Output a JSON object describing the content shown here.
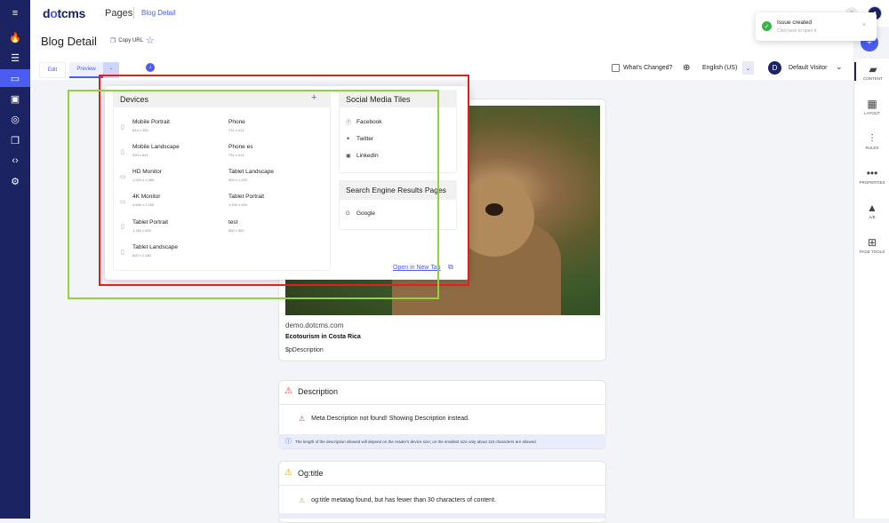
{
  "sidebar": {
    "menu_icon": "menu-icon",
    "items": [
      {
        "icon": "fire-icon",
        "glyph": "🔥"
      },
      {
        "icon": "list-icon",
        "glyph": "☰"
      },
      {
        "icon": "folder-icon",
        "glyph": "▭"
      },
      {
        "icon": "image-icon",
        "glyph": "▣"
      },
      {
        "icon": "target-icon",
        "glyph": "◎"
      },
      {
        "icon": "copy-icon",
        "glyph": "❐"
      },
      {
        "icon": "code-icon",
        "glyph": "‹›"
      },
      {
        "icon": "gear-icon",
        "glyph": "⚙"
      }
    ]
  },
  "header": {
    "logo_prefix": "d",
    "logo_dot": "o",
    "logo_suffix": "tcms",
    "breadcrumb_root": "Pages",
    "breadcrumb_current": "Blog Detail"
  },
  "titlebar": {
    "page_title": "Blog Detail",
    "copy_url": "Copy URL"
  },
  "toolbar": {
    "tab_edit": "Edit",
    "tab_preview": "Preview",
    "whats_changed": "What's Changed?",
    "language": "English (US)",
    "visitor_initial": "D",
    "visitor": "Default Visitor"
  },
  "right_panel": [
    {
      "label": "CONTENT",
      "icon": "content-icon",
      "glyph": "▰"
    },
    {
      "label": "LAYOUT",
      "icon": "layout-icon",
      "glyph": "▦"
    },
    {
      "label": "RULES",
      "icon": "rules-icon",
      "glyph": "⫶"
    },
    {
      "label": "PROPERTIES",
      "icon": "properties-icon",
      "glyph": "•••"
    },
    {
      "label": "A/B",
      "icon": "ab-flask-icon",
      "glyph": "▲"
    },
    {
      "label": "PAGE TOOLS",
      "icon": "page-tools-icon",
      "glyph": "⊞"
    }
  ],
  "preview": {
    "url": "demo.dotcms.com",
    "title": "Ecotourism in Costa Rica",
    "description": "$pDescription"
  },
  "description_section": {
    "title": "Description",
    "message": "Meta Description not found! Showing Description instead.",
    "info": "The length of the description allowed will depend on the reader's device size; on the smallest size only about 110 characters are allowed."
  },
  "og_section": {
    "title": "Og:title",
    "message": "og:title metatag found, but has fewer than 30 characters of content."
  },
  "devices": {
    "heading": "Devices",
    "left": [
      {
        "name": "Mobile Portrait",
        "size": "844 x 390"
      },
      {
        "name": "Mobile Landscape",
        "size": "390 x 844"
      },
      {
        "name": "HD Monitor",
        "size": "1,920 x 1,080"
      },
      {
        "name": "4K Monitor",
        "size": "3,840 x 2,160"
      },
      {
        "name": "Tablet Portrait",
        "size": "1,180 x 820"
      },
      {
        "name": "Tablet Landscape",
        "size": "820 x 1,180"
      }
    ],
    "right": [
      {
        "name": "Phone",
        "size": "731 x 414"
      },
      {
        "name": "Phone es",
        "size": "731 x 414"
      },
      {
        "name": "Tablet Landscape",
        "size": "900 x 1,200"
      },
      {
        "name": "Tablet Portrait",
        "size": "1,200 x 900"
      },
      {
        "name": "test",
        "size": "500 x 500"
      }
    ]
  },
  "social": {
    "heading": "Social Media Tiles",
    "items": [
      "Facebook",
      "Twitter",
      "LinkedIn"
    ]
  },
  "search_engine": {
    "heading": "Search Engine Results Pages",
    "items": [
      "Google"
    ]
  },
  "open_new_tab": "Open in New Tab",
  "toast": {
    "title": "Issue created",
    "subtitle": "Click here to open it"
  },
  "colors": {
    "sidebar": "#1b2363",
    "accent": "#4b5df0",
    "annotation_red": "#e02020",
    "annotation_green": "#8fd43c",
    "success": "#3cb24a",
    "error": "#e04444",
    "warning": "#e7a31a"
  }
}
